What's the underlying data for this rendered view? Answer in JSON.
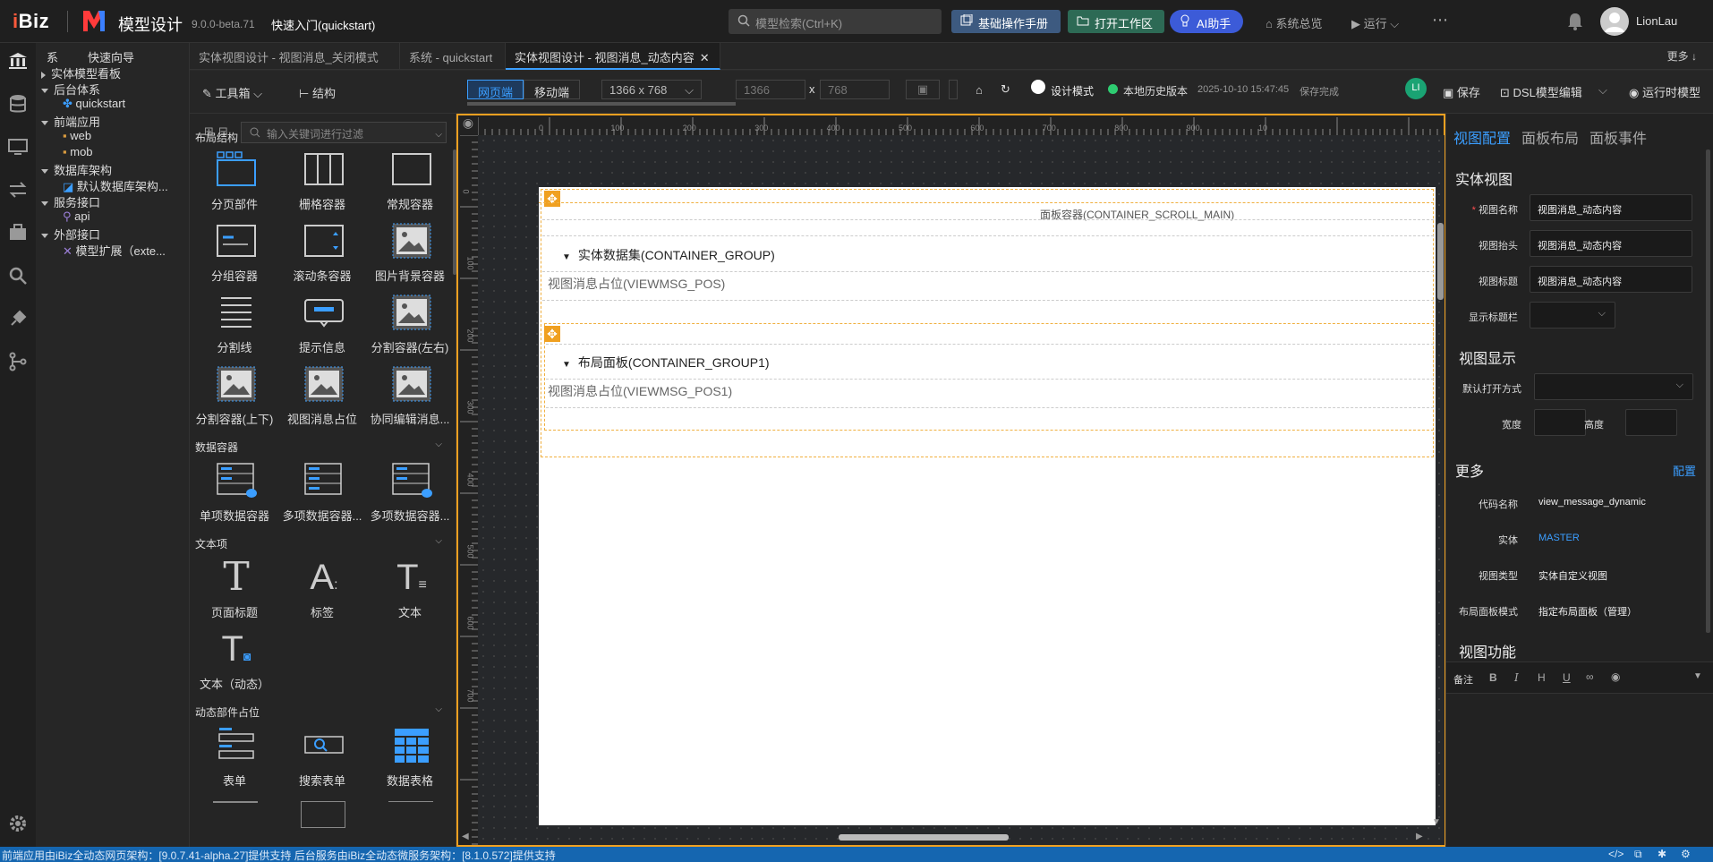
{
  "header": {
    "brand": "Biz",
    "app_title": "模型设计",
    "version": "9.0.0-beta.71",
    "project": "快速入门(quickstart)",
    "search_placeholder": "模型检索(Ctrl+K)",
    "btn_manual": "基础操作手册",
    "btn_open_workspace": "打开工作区",
    "btn_ai": "AI助手",
    "link_home": "系统总览",
    "link_run": "运行",
    "user": "LionLau"
  },
  "tree": {
    "head_left": "系",
    "head_right": "快速向导",
    "items": [
      "实体模型看板",
      "后台体系",
      "quickstart",
      "前端应用",
      "web",
      "mob",
      "数据库架构",
      "默认数据库架构...",
      "服务接口",
      "api",
      "外部接口",
      "模型扩展（exte..."
    ]
  },
  "tabs": [
    "实体视图设计 - 视图消息_关闭模式",
    "系统 - quickstart",
    "实体视图设计 - 视图消息_动态内容"
  ],
  "tabs_more": "更多",
  "toolbar": {
    "toolbox": "工具箱",
    "structure": "结构",
    "web": "网页端",
    "mobile": "移动端",
    "resolution": "1366 x 768",
    "width": "1366",
    "height": "768",
    "x": "x",
    "design_mode": "设计模式",
    "history": "本地历史版本",
    "timestamp": "2025-10-10 15:47:45",
    "save_status": "保存完成",
    "avatar": "LI",
    "save": "保存",
    "dsl": "DSL模型编辑",
    "runtime": "运行时模型"
  },
  "palette": {
    "filter_placeholder": "输入关键词进行过滤",
    "sections": [
      {
        "title": "布局结构",
        "items": [
          "分页部件",
          "栅格容器",
          "常规容器",
          "分组容器",
          "滚动条容器",
          "图片背景容器",
          "分割线",
          "提示信息",
          "分割容器(左右)",
          "分割容器(上下)",
          "视图消息占位",
          "协同编辑消息..."
        ]
      },
      {
        "title": "数据容器",
        "items": [
          "单项数据容器",
          "多项数据容器...",
          "多项数据容器..."
        ]
      },
      {
        "title": "文本项",
        "items": [
          "页面标题",
          "标签",
          "文本",
          "文本（动态）"
        ]
      },
      {
        "title": "动态部件占位",
        "items": [
          "表单",
          "搜索表单",
          "数据表格"
        ]
      }
    ]
  },
  "ruler": {
    "top": [
      "0",
      "100",
      "200",
      "300",
      "400",
      "500",
      "600",
      "700",
      "800",
      "900",
      "10"
    ],
    "left": [
      "0",
      "100",
      "200",
      "300",
      "400",
      "500",
      "600",
      "700"
    ]
  },
  "canvas": {
    "scroll_main": "面板容器(CONTAINER_SCROLL_MAIN)",
    "group1": "实体数据集(CONTAINER_GROUP)",
    "msg1": "视图消息占位(VIEWMSG_POS)",
    "group2": "布局面板(CONTAINER_GROUP1)",
    "msg2": "视图消息占位(VIEWMSG_POS1)"
  },
  "props": {
    "tabs": [
      "视图配置",
      "面板布局",
      "面板事件"
    ],
    "sec_entity": "实体视图",
    "view_name_label": "视图名称",
    "view_name": "视图消息_动态内容",
    "view_caption_label": "视图抬头",
    "view_caption": "视图消息_动态内容",
    "view_title_label": "视图标题",
    "view_title": "视图消息_动态内容",
    "show_title_label": "显示标题栏",
    "sec_display": "视图显示",
    "open_mode_label": "默认打开方式",
    "width_label": "宽度",
    "height_label": "高度",
    "sec_more": "更多",
    "config": "配置",
    "code_label": "代码名称",
    "code": "view_message_dynamic",
    "entity_label": "实体",
    "entity": "MASTER",
    "type_label": "视图类型",
    "type": "实体自定义视图",
    "layout_label": "布局面板模式",
    "layout": "指定布局面板（管理）",
    "sec_func": "视图功能",
    "remark": "备注"
  },
  "status_text": "前端应用由iBiz全动态网页架构：[9.0.7.41-alpha.27]提供支持 后台服务由iBiz全动态微服务架构：[8.1.0.572]提供支持",
  "colors": {
    "accent": "#3b9eff",
    "selection": "#f0a020",
    "status": "#1566b0"
  }
}
